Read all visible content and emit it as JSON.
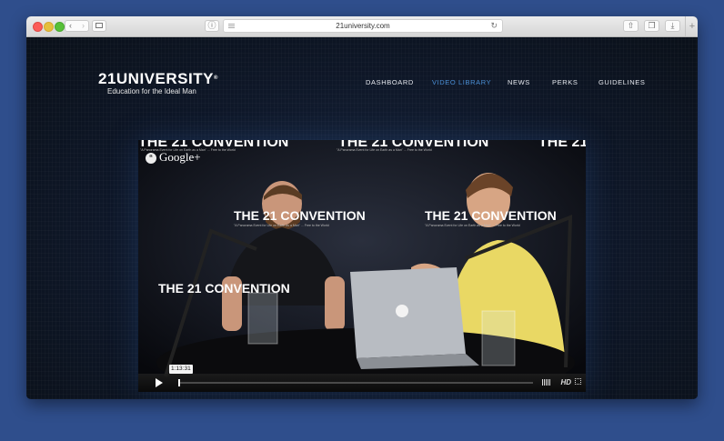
{
  "browser": {
    "url": "21university.com",
    "back_icon": "chevron-left-icon",
    "forward_icon": "chevron-right-icon",
    "sidebar_icon": "sidebar-icon",
    "reader_icon": "reader-icon",
    "reload_icon": "reload-icon",
    "share_icon": "share-icon",
    "tabs_icon": "tabs-icon",
    "download_icon": "download-icon",
    "new_tab_icon": "plus-icon"
  },
  "site": {
    "logo_text": "21UNIVERSITY",
    "logo_mark": "®",
    "tagline": "Education for the Ideal Man"
  },
  "nav": {
    "items": [
      {
        "label": "DASHBOARD",
        "active": false
      },
      {
        "label": "VIDEO LIBRARY",
        "active": true
      },
      {
        "label": "NEWS",
        "active": false
      },
      {
        "label": "PERKS",
        "active": false
      },
      {
        "label": "GUIDELINES",
        "active": false
      }
    ]
  },
  "video": {
    "overlay_brand": "Google+",
    "backdrop_title": "THE 21 CONVENTION",
    "backdrop_subtitle": "\"A Panorama Event for Life on Earth as a Man\" ... Free to the World",
    "current_time": "1:13:31",
    "quality_badge": "HD",
    "progress": 0.0
  },
  "colors": {
    "page_bg": "#2f4e8c",
    "site_bg": "#0d1422",
    "nav_active": "#4a8fd6",
    "nav_text": "#e6e9ef"
  }
}
